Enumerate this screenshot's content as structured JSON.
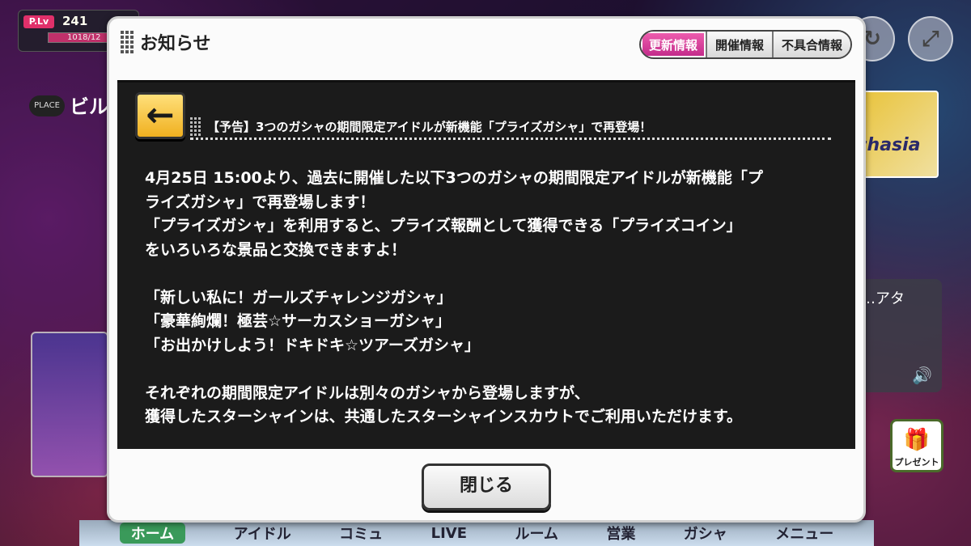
{
  "background": {
    "plv_badge": "P.Lv",
    "plv_value": "241",
    "plv_exp": "1018/12",
    "plv_exp_fraction": 0.82,
    "place_label": "PLACE",
    "place_value": "ビル",
    "card_text": "chasia",
    "bubble_text": "に…アタ",
    "present_label": "プレゼント",
    "nav": [
      "ホーム",
      "アイドル",
      "コミュ",
      "LIVE",
      "ルーム",
      "営業",
      "ガシャ",
      "メニュー"
    ]
  },
  "dialog": {
    "title": "お知らせ",
    "tabs": [
      {
        "label": "更新情報",
        "active": true
      },
      {
        "label": "開催情報",
        "active": false
      },
      {
        "label": "不具合情報",
        "active": false
      }
    ],
    "headline": "【予告】3つのガシャの期間限定アイドルが新機能「プライズガシャ」で再登場！",
    "body_lines": [
      "4月25日 15:00より、過去に開催した以下3つのガシャの期間限定アイドルが新機能「プ",
      "ライズガシャ」で再登場します！",
      "「プライズガシャ」を利用すると、プライズ報酬として獲得できる「プライズコイン」",
      "をいろいろな景品と交換できますよ！",
      "",
      "「新しい私に！ガールズチャレンジガシャ」",
      "「豪華絢爛！極芸☆サーカスショーガシャ」",
      "「お出かけしよう！ドキドキ☆ツアーズガシャ」",
      "",
      "それぞれの期間限定アイドルは別々のガシャから登場しますが、",
      "獲得したスターシャインは、共通したスターシャインスカウトでご利用いただけます。"
    ],
    "close_label": "閉じる"
  },
  "colors": {
    "active_tab": "#d83a9a",
    "back_button": "#f5c330",
    "content_bg": "#1b1b1b"
  },
  "icons": {
    "back": "arrow-left-icon",
    "expand": "expand-arrows-icon",
    "refresh": "refresh-icon",
    "speaker": "speaker-icon",
    "present": "gift-icon"
  }
}
